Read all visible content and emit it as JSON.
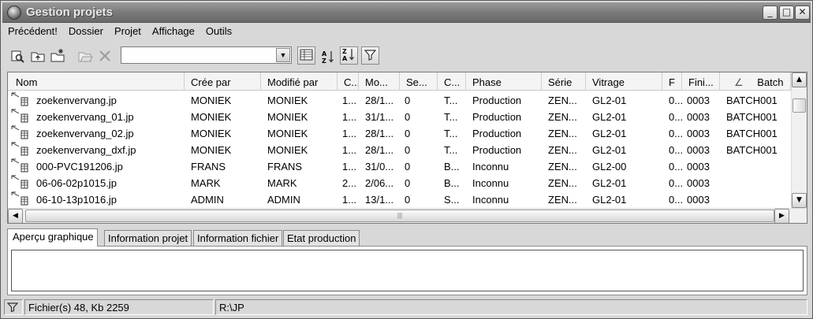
{
  "window": {
    "title": "Gestion projets",
    "buttons": {
      "minimize": "_",
      "maximize": "□",
      "close": "✕"
    }
  },
  "menu": [
    "Précédent!",
    "Dossier",
    "Projet",
    "Affichage",
    "Outils"
  ],
  "toolbar": {
    "combo_value": "",
    "icons": [
      "find-file-icon",
      "folder-up-icon",
      "new-folder-icon",
      "open-folder-icon",
      "delete-icon",
      "columns-view-icon",
      "sort-ascending-icon",
      "sort-descending-icon",
      "filter-icon"
    ]
  },
  "table": {
    "columns": [
      "Nom",
      "Crée par",
      "Modifié par",
      "C...",
      "Mo...",
      "Se...",
      "C...",
      "Phase",
      "Série",
      "Vitrage",
      "F",
      "Fini...",
      "Batch"
    ],
    "sort_indicator": "∠",
    "rows": [
      [
        "zoekenvervang.jp",
        "MONIEK",
        "MONIEK",
        "1...",
        "28/1...",
        "0",
        "T...",
        "Production",
        "ZEN...",
        "GL2-01",
        "0...",
        "0003",
        "BATCH001"
      ],
      [
        "zoekenvervang_01.jp",
        "MONIEK",
        "MONIEK",
        "1...",
        "31/1...",
        "0",
        "T...",
        "Production",
        "ZEN...",
        "GL2-01",
        "0...",
        "0003",
        "BATCH001"
      ],
      [
        "zoekenvervang_02.jp",
        "MONIEK",
        "MONIEK",
        "1...",
        "28/1...",
        "0",
        "T...",
        "Production",
        "ZEN...",
        "GL2-01",
        "0...",
        "0003",
        "BATCH001"
      ],
      [
        "zoekenvervang_dxf.jp",
        "MONIEK",
        "MONIEK",
        "1...",
        "28/1...",
        "0",
        "T...",
        "Production",
        "ZEN...",
        "GL2-01",
        "0...",
        "0003",
        "BATCH001"
      ],
      [
        "000-PVC191206.jp",
        "FRANS",
        "FRANS",
        "1...",
        "31/0...",
        "0",
        "B...",
        "Inconnu",
        "ZEN...",
        "GL2-00",
        "0...",
        "0003",
        ""
      ],
      [
        "06-06-02p1015.jp",
        "MARK",
        "MARK",
        "2...",
        "2/06...",
        "0",
        "B...",
        "Inconnu",
        "ZEN...",
        "GL2-01",
        "0...",
        "0003",
        ""
      ],
      [
        "06-10-13p1016.jp",
        "ADMIN",
        "ADMIN",
        "1...",
        "13/1...",
        "0",
        "S...",
        "Inconnu",
        "ZEN...",
        "GL2-01",
        "0...",
        "0003",
        ""
      ]
    ]
  },
  "tabs": [
    "Aperçu graphique",
    "Information projet",
    "Information fichier",
    "Etat production"
  ],
  "status": {
    "files": "Fichier(s) 48, Kb 2259",
    "path": "R:\\JP"
  }
}
